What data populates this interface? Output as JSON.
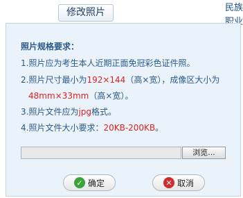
{
  "background": {
    "edit_photo_button": "修改照片",
    "right_top": "民族",
    "right_second": "职业"
  },
  "dialog": {
    "title": "照片规格要求：",
    "lines": [
      {
        "text": "1.照片应为考生本人近期正面免冠彩色证件照。"
      },
      {
        "pre": "2.照片尺寸最小为",
        "red": "192×144",
        "post": "（高×宽），成像区大小为"
      },
      {
        "red": "48mm×33mm",
        "post": "（高×宽）。"
      },
      {
        "pre": "3.照片文件应为",
        "red": "jpg",
        "post": "格式。"
      },
      {
        "pre": "4.照片文件大小要求：",
        "red": "20KB-200KB",
        "post": "。"
      }
    ],
    "file_input_value": "",
    "browse_label": "浏览...",
    "confirm_label": "确定",
    "cancel_label": "取消"
  },
  "colors": {
    "dialog_bg": "#eaf2fa",
    "text": "#2b5a8a",
    "highlight": "#e02020",
    "confirm_icon": "#3aa33a",
    "cancel_icon": "#d22b2b"
  },
  "icons": {
    "confirm": "check-icon",
    "cancel": "close-icon"
  }
}
